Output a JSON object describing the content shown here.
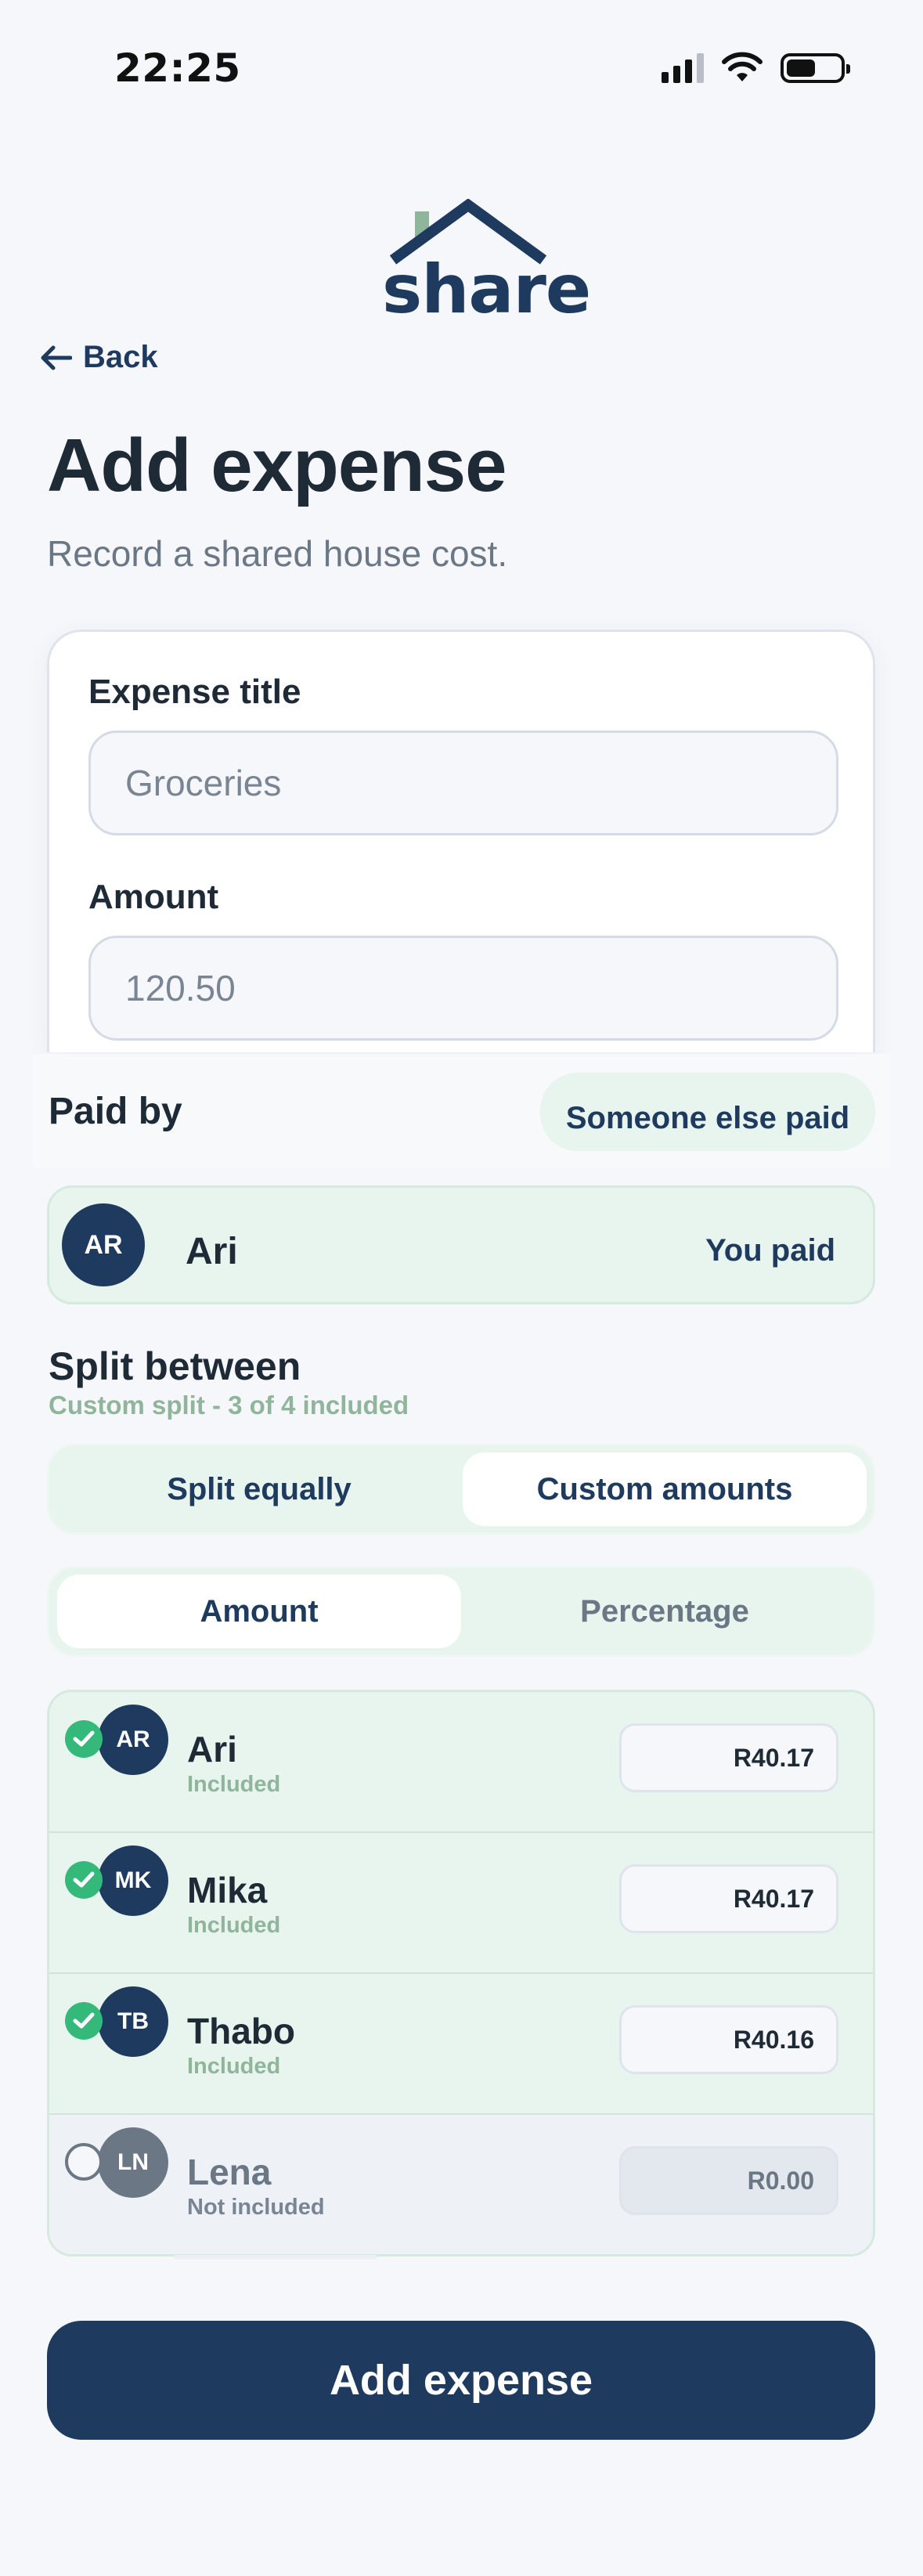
{
  "status_bar": {
    "time": "22:25"
  },
  "brand": {
    "logo_text": "share",
    "primary_color": "#1e3a5f",
    "accent_color": "#8fb59a"
  },
  "nav": {
    "back_label": "Back"
  },
  "header": {
    "title": "Add expense",
    "subtitle": "Record a shared house cost."
  },
  "form": {
    "title_label": "Expense title",
    "title_placeholder": "Groceries",
    "amount_label": "Amount",
    "amount_placeholder": "120.50"
  },
  "paid_by": {
    "label": "Paid by",
    "someone_else_button": "Someone else paid",
    "payer": {
      "initials": "AR",
      "name": "Ari",
      "tag": "You paid"
    }
  },
  "split": {
    "title": "Split between",
    "summary": "Custom split - 3 of 4 included",
    "mode_options": [
      "Split equally",
      "Custom amounts"
    ],
    "mode_selected": "Custom amounts",
    "unit_options": [
      "Amount",
      "Percentage"
    ],
    "unit_selected": "Amount",
    "people": [
      {
        "initials": "AR",
        "name": "Ari",
        "status": "Included",
        "amount": "R40.17",
        "included": true
      },
      {
        "initials": "MK",
        "name": "Mika",
        "status": "Included",
        "amount": "R40.17",
        "included": true
      },
      {
        "initials": "TB",
        "name": "Thabo",
        "status": "Included",
        "amount": "R40.16",
        "included": true
      },
      {
        "initials": "LN",
        "name": "Lena",
        "status": "Not included",
        "amount": "R0.00",
        "included": false
      }
    ]
  },
  "submit": {
    "label": "Add expense"
  }
}
